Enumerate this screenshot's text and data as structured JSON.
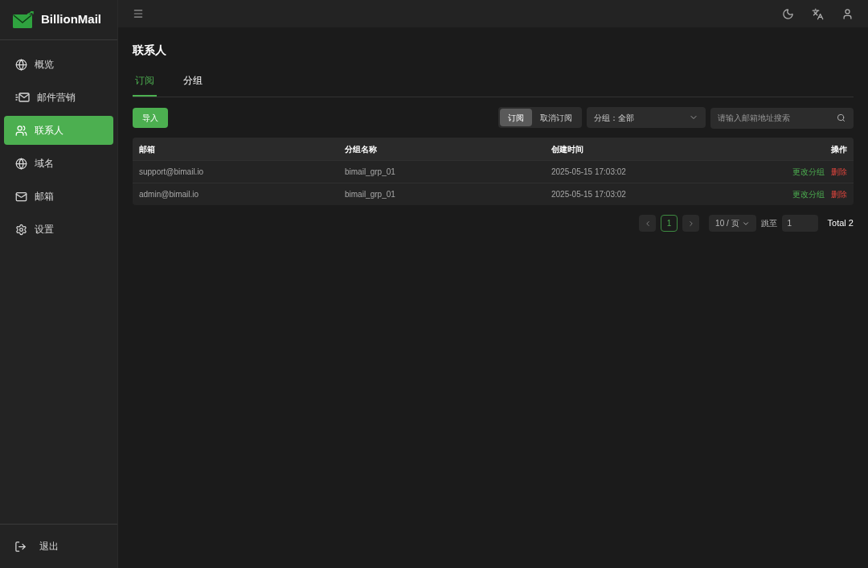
{
  "brand": "BillionMail",
  "sidebar": {
    "items": [
      {
        "label": "概览",
        "selected": false
      },
      {
        "label": "邮件营销",
        "selected": false
      },
      {
        "label": "联系人",
        "selected": true
      },
      {
        "label": "域名",
        "selected": false
      },
      {
        "label": "邮箱",
        "selected": false
      },
      {
        "label": "设置",
        "selected": false
      }
    ],
    "logout": "退出"
  },
  "page_title": "联系人",
  "tabs": [
    {
      "label": "订阅",
      "selected": true
    },
    {
      "label": "分组",
      "selected": false
    }
  ],
  "import_button": "导入",
  "status_toggle": [
    {
      "label": "订阅",
      "selected": true
    },
    {
      "label": "取消订阅",
      "selected": false
    }
  ],
  "group_select": {
    "value": "分组：全部"
  },
  "search": {
    "placeholder": "请输入邮箱地址搜索"
  },
  "table": {
    "columns": [
      "邮箱",
      "分组名称",
      "创建时间",
      "操作"
    ],
    "rows": [
      {
        "email": "support@bimail.io",
        "group": "bimail_grp_01",
        "created": "2025-05-15 17:03:02",
        "actions": [
          "更改分组",
          "删除"
        ]
      },
      {
        "email": "admin@bimail.io",
        "group": "bimail_grp_01",
        "created": "2025-05-15 17:03:02",
        "actions": [
          "更改分组",
          "删除"
        ]
      }
    ]
  },
  "pagination": {
    "pages": [
      {
        "label": "1",
        "selected": true
      }
    ],
    "page_size": "10 / 页",
    "jump_label": "跳至",
    "jump_value": "1",
    "total": "Total 2"
  }
}
